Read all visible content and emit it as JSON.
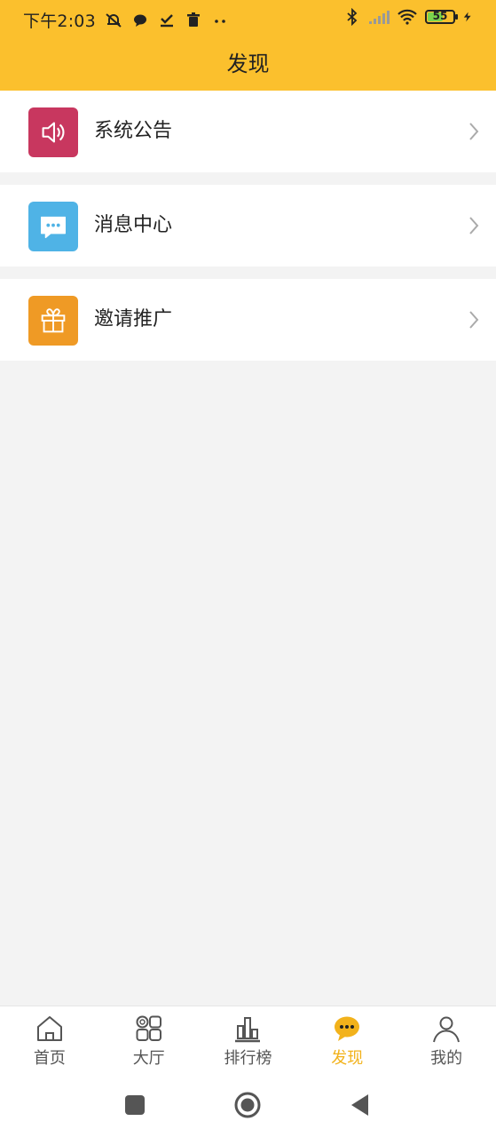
{
  "status_bar": {
    "time": "下午2:03",
    "battery": "55",
    "icons": [
      "mute-bell-icon",
      "chat-bubble-icon",
      "check-icon",
      "trash-icon",
      "more-dots-icon",
      "bluetooth-icon",
      "signal-icon",
      "wifi-icon",
      "battery-icon",
      "charging-icon"
    ]
  },
  "header": {
    "title": "发现"
  },
  "menu": {
    "items": [
      {
        "label": "系统公告",
        "icon": "speaker-icon",
        "color": "#c8375f"
      },
      {
        "label": "消息中心",
        "icon": "message-icon",
        "color": "#4fb3e6"
      },
      {
        "label": "邀请推广",
        "icon": "gift-icon",
        "color": "#ef9a25"
      }
    ]
  },
  "bottom_nav": {
    "items": [
      {
        "label": "首页",
        "icon": "home-icon"
      },
      {
        "label": "大厅",
        "icon": "grid-icon"
      },
      {
        "label": "排行榜",
        "icon": "ranking-icon"
      },
      {
        "label": "发现",
        "icon": "discover-chat-icon",
        "active": true
      },
      {
        "label": "我的",
        "icon": "profile-icon"
      }
    ],
    "active_color": "#f2b21b"
  },
  "system_nav": {
    "buttons": [
      "recent-apps-icon",
      "home-circle-icon",
      "back-icon"
    ]
  },
  "colors": {
    "header_bg": "#fbc02d",
    "page_bg": "#f3f3f3"
  }
}
